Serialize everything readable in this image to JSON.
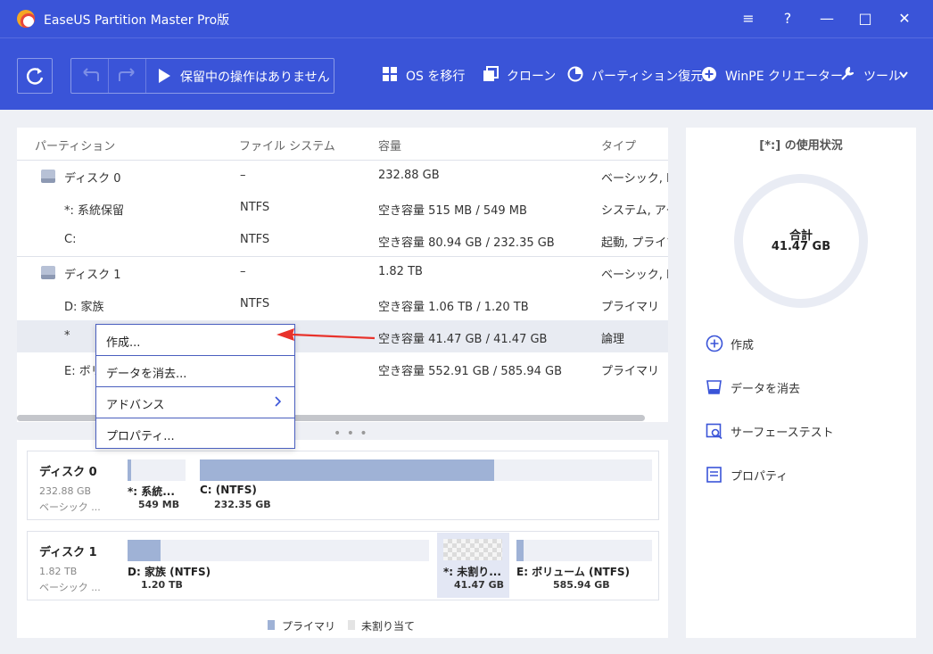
{
  "app": {
    "title": "EaseUS Partition Master Pro版"
  },
  "window_buttons": [
    "≡",
    "?",
    "—",
    "□",
    "✕"
  ],
  "toolbar": {
    "pending_label": "保留中の操作はありません",
    "items": [
      {
        "label": "OS を移行",
        "icon": "windows-icon"
      },
      {
        "label": "クローン",
        "icon": "clone-icon"
      },
      {
        "label": "パーティション復元",
        "icon": "pie-icon"
      },
      {
        "label": "WinPE クリエーター",
        "icon": "plus-circle-icon"
      },
      {
        "label": "ツール",
        "icon": "wrench-icon"
      }
    ]
  },
  "table": {
    "headers": [
      "パーティション",
      "ファイル システム",
      "容量",
      "タイプ"
    ],
    "rows": [
      {
        "name": "ディスク 0",
        "fs": "–",
        "capacity": "232.88 GB",
        "type": "ベーシック, MB"
      },
      {
        "name": "*: 系統保留",
        "fs": "NTFS",
        "capacity": "空き容量 515 MB / 549 MB",
        "type": "システム, アクテ"
      },
      {
        "name": "C:",
        "fs": "NTFS",
        "capacity": "空き容量 80.94 GB / 232.35 GB",
        "type": "起動, プライマ"
      },
      {
        "name": "ディスク 1",
        "fs": "–",
        "capacity": "1.82 TB",
        "type": "ベーシック, MB"
      },
      {
        "name": "D: 家族",
        "fs": "NTFS",
        "capacity": "空き容量 1.06 TB / 1.20 TB",
        "type": "プライマリ"
      },
      {
        "name": "*",
        "fs": "",
        "capacity": "空き容量 41.47 GB / 41.47 GB",
        "type": "論理"
      },
      {
        "name": "E: ボリ",
        "fs": "",
        "capacity": "空き容量 552.91 GB / 585.94 GB",
        "type": "プライマリ"
      }
    ]
  },
  "context_menu": {
    "items": [
      "作成...",
      "データを消去...",
      "アドバンス",
      "プロパティ..."
    ]
  },
  "disks": [
    {
      "name": "ディスク 0",
      "size": "232.88 GB",
      "type": "ベーシック ...",
      "partitions": [
        {
          "label": "*: 系統...",
          "size": "549 MB",
          "used_fraction": 0.06
        },
        {
          "label": "C: (NTFS)",
          "size": "232.35 GB",
          "used_fraction": 0.65
        }
      ]
    },
    {
      "name": "ディスク 1",
      "size": "1.82 TB",
      "type": "ベーシック ...",
      "partitions": [
        {
          "label": "D: 家族 (NTFS)",
          "size": "1.20 TB",
          "used_fraction": 0.11
        },
        {
          "label": "*: 未割り...",
          "size": "41.47 GB",
          "used_fraction": 0
        },
        {
          "label": "E: ボリューム (NTFS)",
          "size": "585.94 GB",
          "used_fraction": 0.05
        }
      ]
    }
  ],
  "legend": {
    "primary": "プライマリ",
    "unallocated": "未割り当て"
  },
  "usage": {
    "title": "[*:] の使用状況",
    "total_label": "合計",
    "total_value": "41.47 GB"
  },
  "actions": [
    {
      "label": "作成",
      "icon": "plus-circle-icon"
    },
    {
      "label": "データを消去",
      "icon": "eraser-icon"
    },
    {
      "label": "サーフェーステスト",
      "icon": "surface-test-icon"
    },
    {
      "label": "プロパティ",
      "icon": "properties-icon"
    }
  ],
  "colors": {
    "brand": "#3a54d8",
    "primary_partition": "#9fb2d6",
    "arrow": "#e8322b"
  }
}
